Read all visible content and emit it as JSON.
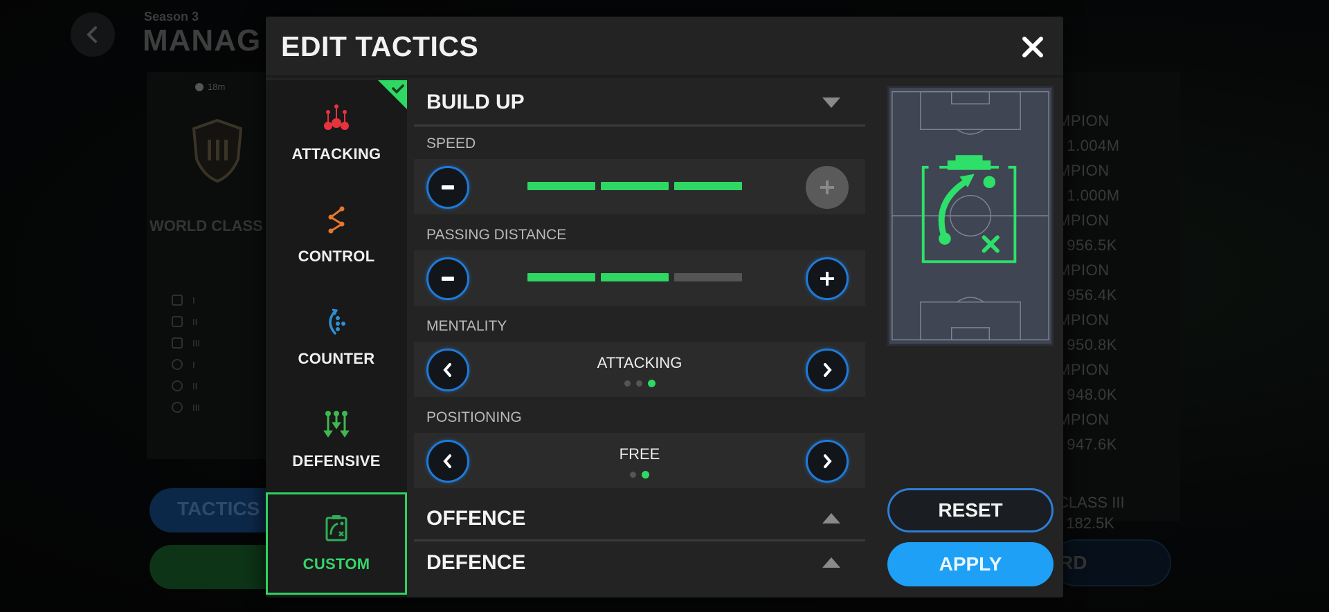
{
  "background": {
    "season": "Season 3",
    "title": "MANAG",
    "timer": "18m",
    "league": "WORLD CLASS",
    "ranks": [
      "I",
      "II",
      "III",
      "I",
      "II",
      "III"
    ],
    "tactics_button": "TACTICS",
    "leaderboard": [
      "MPION",
      ": 1.004M",
      "MPION",
      ": 1.000M",
      "MPION",
      ": 956.5K",
      "MPION",
      ": 956.4K",
      "MPION",
      ": 950.8K",
      "MPION",
      ": 948.0K",
      "MPION",
      ": 947.6K"
    ],
    "bottom_card": [
      "CLASS III",
      ": 182.5K"
    ],
    "bottom_button": "RD",
    "top_icons": [
      "target-icon",
      "cart-icon",
      "home-icon",
      "wifi-icon"
    ]
  },
  "modal": {
    "title": "EDIT TACTICS",
    "close_icon": "close-icon",
    "nav": [
      {
        "label": "ATTACKING",
        "icon": "attacking-icon",
        "color": "#e8333f",
        "applied": true
      },
      {
        "label": "CONTROL",
        "icon": "control-icon",
        "color": "#e8772e"
      },
      {
        "label": "COUNTER",
        "icon": "counter-icon",
        "color": "#2e8fd4"
      },
      {
        "label": "DEFENSIVE",
        "icon": "defensive-icon",
        "color": "#3fb84f"
      },
      {
        "label": "CUSTOM",
        "icon": "clipboard-icon",
        "color": "#36d46a",
        "active": true
      }
    ],
    "sections": {
      "build_up": {
        "label": "BUILD UP",
        "expanded": true,
        "speed": {
          "label": "SPEED",
          "level": 3,
          "max": 3
        },
        "passing_distance": {
          "label": "PASSING DISTANCE",
          "level": 2,
          "max": 3
        },
        "mentality": {
          "label": "MENTALITY",
          "value": "ATTACKING",
          "index": 3,
          "count": 3
        },
        "positioning": {
          "label": "POSITIONING",
          "value": "FREE",
          "index": 2,
          "count": 2
        }
      },
      "offence": {
        "label": "OFFENCE",
        "expanded": false
      },
      "defence": {
        "label": "DEFENCE",
        "expanded": false
      }
    },
    "buttons": {
      "reset": "RESET",
      "apply": "APPLY"
    },
    "colors": {
      "accent_green": "#2ed862",
      "accent_blue": "#1ea0f6"
    }
  }
}
